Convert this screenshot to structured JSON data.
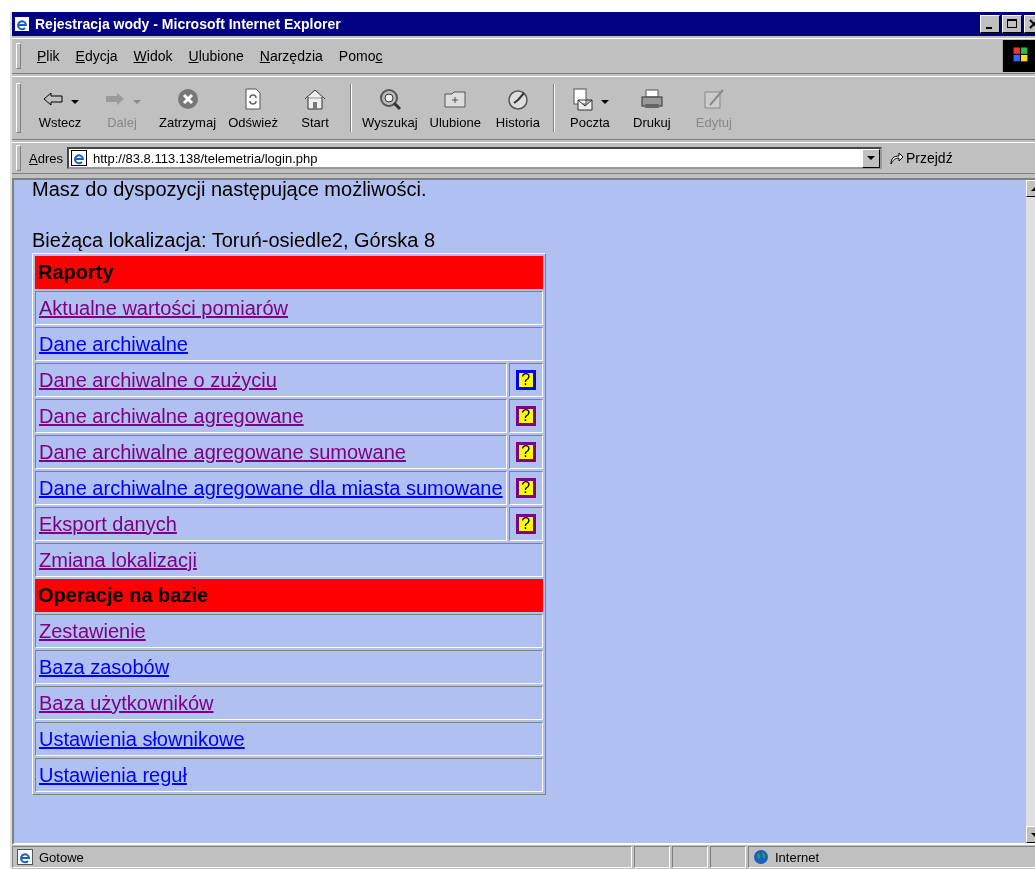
{
  "window": {
    "title": "Rejestracja wody - Microsoft Internet Explorer"
  },
  "menu": [
    {
      "key": "P",
      "after": "lik"
    },
    {
      "key": "E",
      "after": "dycja"
    },
    {
      "key": "W",
      "after": "idok"
    },
    {
      "key": "U",
      "after": "lubione"
    },
    {
      "key": "N",
      "after": "arzędzia"
    },
    {
      "before": "Pomo",
      "key": "c"
    }
  ],
  "toolbar": [
    {
      "label": "Wstecz",
      "disabled": false,
      "dropdown": true
    },
    {
      "label": "Dalej",
      "disabled": true,
      "dropdown": true
    },
    {
      "label": "Zatrzymaj",
      "disabled": false,
      "dropdown": false
    },
    {
      "label": "Odśwież",
      "disabled": false,
      "dropdown": false
    },
    {
      "label": "Start",
      "disabled": false,
      "dropdown": false,
      "separator_after": true
    },
    {
      "label": "Wyszukaj",
      "disabled": false,
      "dropdown": false
    },
    {
      "label": "Ulubione",
      "disabled": false,
      "dropdown": false
    },
    {
      "label": "Historia",
      "disabled": false,
      "dropdown": false,
      "separator_after": true
    },
    {
      "label": "Poczta",
      "disabled": false,
      "dropdown": true
    },
    {
      "label": "Drukuj",
      "disabled": false,
      "dropdown": false
    },
    {
      "label": "Edytuj",
      "disabled": true,
      "dropdown": false
    }
  ],
  "address": {
    "key": "A",
    "after": "dres",
    "url": "http://83.8.113.138/telemetria/login.php",
    "go": "Przejdź"
  },
  "page": {
    "intro": "Masz do dyspozycji następujące możliwości.",
    "location": "Bieżąca lokalizacja: Toruń-osiedle2, Górska 8",
    "rows": [
      {
        "kind": "header",
        "label": "Raporty"
      },
      {
        "kind": "link",
        "label": "Aktualne wartości pomiarów",
        "visited": true
      },
      {
        "kind": "link",
        "label": "Dane archiwalne",
        "visited": false
      },
      {
        "kind": "link",
        "label": "Dane archiwalne o zużyciu",
        "visited": true,
        "help": {
          "label": "?",
          "visited": false
        }
      },
      {
        "kind": "link",
        "label": "Dane archiwalne agregowane",
        "visited": true,
        "help": {
          "label": "?",
          "visited": true
        }
      },
      {
        "kind": "link",
        "label": "Dane archiwalne agregowane sumowane",
        "visited": true,
        "help": {
          "label": "?",
          "visited": true
        }
      },
      {
        "kind": "link",
        "label": "Dane archiwalne agregowane dla miasta sumowane",
        "visited": false,
        "help": {
          "label": "?",
          "visited": true
        }
      },
      {
        "kind": "link",
        "label": "Eksport danych",
        "visited": true,
        "help": {
          "label": "?",
          "visited": true
        }
      },
      {
        "kind": "link",
        "label": "Zmiana lokalizacji",
        "visited": true
      },
      {
        "kind": "header",
        "label": "Operacje na bazie"
      },
      {
        "kind": "link",
        "label": "Zestawienie",
        "visited": true
      },
      {
        "kind": "link",
        "label": "Baza zasobów",
        "visited": false
      },
      {
        "kind": "link",
        "label": "Baza użytkowników",
        "visited": true
      },
      {
        "kind": "link",
        "label": "Ustawienia słownikowe",
        "visited": false
      },
      {
        "kind": "link",
        "label": "Ustawienia reguł",
        "visited": false
      }
    ]
  },
  "status_bar": {
    "text": "Gotowe",
    "zone": "Internet"
  }
}
